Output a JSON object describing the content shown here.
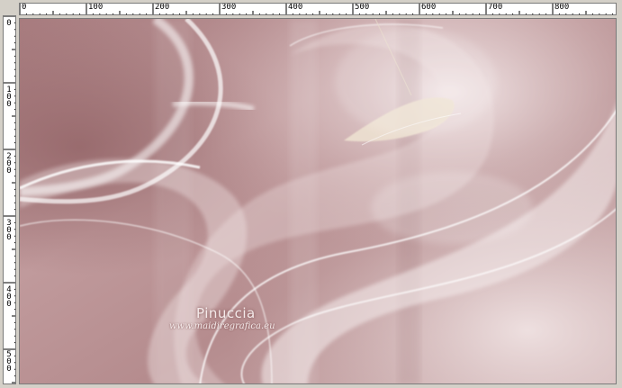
{
  "rulers": {
    "top_labels": [
      "0",
      "100",
      "200",
      "300",
      "400",
      "500",
      "600",
      "700",
      "800"
    ],
    "left_labels": [
      "0",
      "100",
      "200",
      "300",
      "400",
      "500"
    ]
  },
  "canvas": {
    "watermark": "Pinuccia",
    "watermark_url": "www.maidiregrafica.eu",
    "colors": {
      "base": "#b48a8c",
      "light": "#eadcdc",
      "highlight": "#ffffff",
      "dark": "#8e5f62"
    }
  }
}
